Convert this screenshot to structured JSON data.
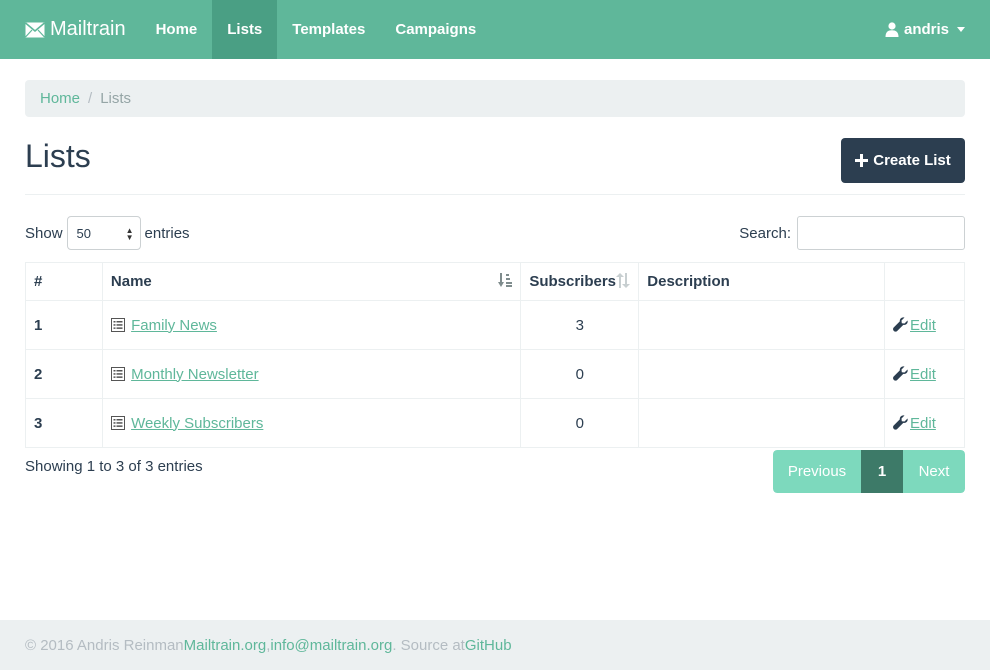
{
  "navbar": {
    "brand": "Mailtrain",
    "items": [
      {
        "label": "Home",
        "active": false
      },
      {
        "label": "Lists",
        "active": true
      },
      {
        "label": "Templates",
        "active": false
      },
      {
        "label": "Campaigns",
        "active": false
      }
    ],
    "user": "andris"
  },
  "breadcrumb": {
    "home": "Home",
    "separator": "/",
    "current": "Lists"
  },
  "page": {
    "title": "Lists",
    "create_button": "Create List"
  },
  "controls": {
    "show_label": "Show",
    "entries_value": "50",
    "entries_label": "entries",
    "search_label": "Search:",
    "search_value": ""
  },
  "table": {
    "headers": [
      "#",
      "Name",
      "Subscribers",
      "Description",
      ""
    ],
    "rows": [
      {
        "num": "1",
        "name": "Family News",
        "subscribers": "3",
        "description": "",
        "action": "Edit"
      },
      {
        "num": "2",
        "name": "Monthly Newsletter",
        "subscribers": "0",
        "description": "",
        "action": "Edit"
      },
      {
        "num": "3",
        "name": "Weekly Subscribers",
        "subscribers": "0",
        "description": "",
        "action": "Edit"
      }
    ]
  },
  "pagination": {
    "info": "Showing 1 to 3 of 3 entries",
    "previous": "Previous",
    "current": "1",
    "next": "Next"
  },
  "footer": {
    "prefix": "© 2016 Andris Reinman ",
    "site": "Mailtrain.org",
    "comma": ", ",
    "email": "info@mailtrain.org",
    "source_text": ". Source at ",
    "github": "GitHub"
  },
  "colors": {
    "navbar": "#5fb79a",
    "primary_dark": "#2c3e50",
    "link": "#5fb79a",
    "pagination_active": "#3d7a68"
  }
}
